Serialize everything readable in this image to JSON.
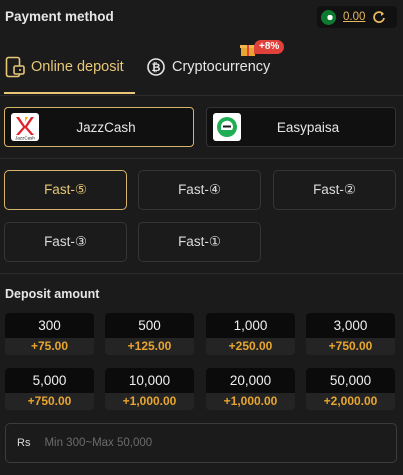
{
  "header": {
    "title": "Payment method",
    "balance": "0.00"
  },
  "tabs": [
    {
      "label": "Online deposit",
      "active": true
    },
    {
      "label": "Cryptocurrency",
      "active": false,
      "badge": "+8%"
    }
  ],
  "methods": [
    {
      "label": "JazzCash",
      "logo_text": "JazzCash",
      "selected": true
    },
    {
      "label": "Easypaisa",
      "selected": false
    }
  ],
  "channels": [
    {
      "label": "Fast-⑤",
      "active": true
    },
    {
      "label": "Fast-④",
      "active": false
    },
    {
      "label": "Fast-②",
      "active": false
    },
    {
      "label": "Fast-③",
      "active": false
    },
    {
      "label": "Fast-①",
      "active": false
    }
  ],
  "deposit": {
    "title": "Deposit amount",
    "amounts": [
      {
        "value": "300",
        "bonus": "+75.00"
      },
      {
        "value": "500",
        "bonus": "+125.00"
      },
      {
        "value": "1,000",
        "bonus": "+250.00"
      },
      {
        "value": "3,000",
        "bonus": "+750.00"
      },
      {
        "value": "5,000",
        "bonus": "+750.00"
      },
      {
        "value": "10,000",
        "bonus": "+1,000.00"
      },
      {
        "value": "20,000",
        "bonus": "+1,000.00"
      },
      {
        "value": "50,000",
        "bonus": "+2,000.00"
      }
    ],
    "currency": "Rs",
    "placeholder": "Min 300~Max 50,000"
  },
  "colors": {
    "accent": "#e8c778",
    "bonus": "#e8a630",
    "badge": "#e0413a",
    "background": "#1b1b1b"
  }
}
